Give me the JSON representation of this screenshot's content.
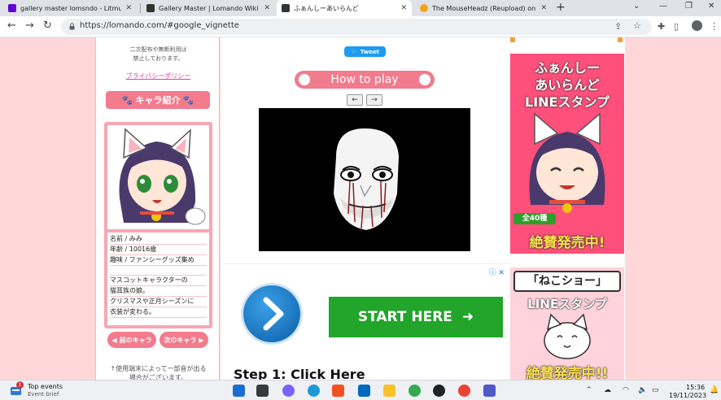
{
  "browser": {
    "tabs": [
      {
        "title": "gallery master lomsndo - Litmus",
        "favicon_color": "#6001d2"
      },
      {
        "title": "Gallery Master | Lomando Wiki |",
        "favicon_color": "#333333"
      },
      {
        "title": "ふぁんしーあいらんど",
        "favicon_color": "#333333"
      },
      {
        "title": "The MouseHeadz (Reupload) on",
        "favicon_color": "#f4a21a"
      }
    ],
    "new_tab": "+",
    "address": "https://lomando.com/#google_vignette"
  },
  "left_sidebar": {
    "notice_top": [
      "二次配布や無断利用は",
      "禁止しております。"
    ],
    "privacy_link": "プライバシーポリシー",
    "chara_header": "キャラ紹介",
    "chara_info": [
      "名前 / みみ",
      "年齢 / 10016歳",
      "趣味 / ファンシーグッズ集め",
      "",
      "マスコットキャラクターの",
      "猫耳族の娘。",
      "クリスマスや正月シーズンに",
      "衣装が変わる。"
    ],
    "prev_button": "前のキャラ",
    "next_button": "次のキャラ",
    "footer_note": [
      "↑使用端末によって一部音が出る",
      "場合がございます。"
    ]
  },
  "main": {
    "tweet_button": "Tweet",
    "how_to_play": "How to play",
    "prev_arrow": "←",
    "next_arrow": "→"
  },
  "ad": {
    "info_icons": "ⓘ ✕",
    "start_button": "START HERE",
    "start_arrow": "➜",
    "step_text": "Step 1: Click Here"
  },
  "right_sidebar": {
    "banner1_line1": "ふぁんしー",
    "banner1_line2": "あいらんど",
    "banner1_line3": "LINEスタンプ",
    "banner1_badge": "全40種",
    "banner1_bottom": "絶賛発売中!",
    "banner2_line1": "「ねこショー」",
    "banner2_line2": "LINEスタンプ",
    "banner2_bottom": "絶賛発売中!!"
  },
  "taskbar": {
    "weather_badge": "1",
    "events_title": "Top events",
    "events_sub": "Event brief",
    "time": "15:36",
    "date": "19/11/2023"
  },
  "colors": {
    "page_pink": "#ffd7d9",
    "accent_pink": "#f27b8d",
    "ad_green": "#22a52a",
    "tweet_blue": "#1d9bf0"
  }
}
